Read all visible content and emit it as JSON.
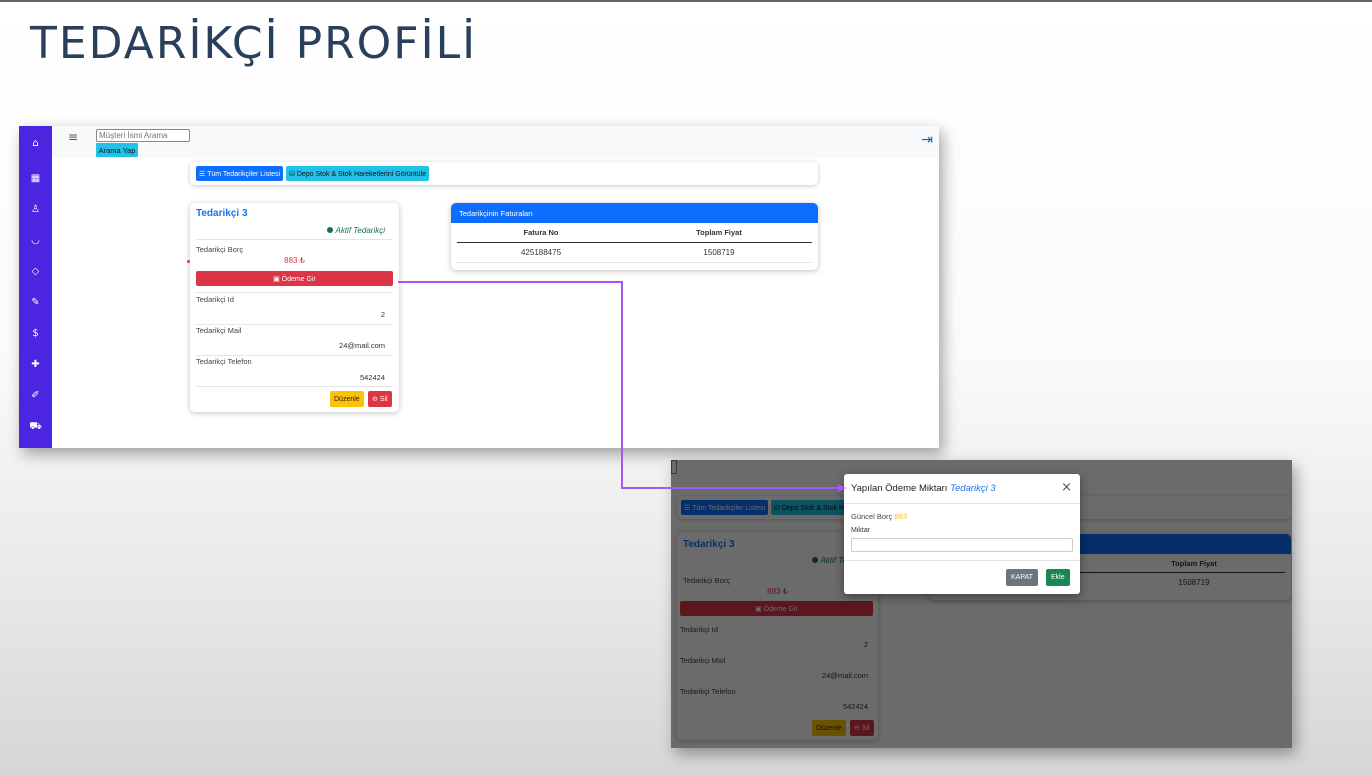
{
  "slide": {
    "title": "TEDARİKÇİ PROFİLİ"
  },
  "app": {
    "search_placeholder": "Müşteri İsmi Arama",
    "search_button": "Arama Yap",
    "sidebar_icons": [
      "home-icon",
      "grid-icon",
      "user-icon",
      "basket-icon",
      "tag-icon",
      "pencil-icon",
      "dollar-icon",
      "plus-icon",
      "brush-icon",
      "truck-icon"
    ],
    "buttons": {
      "all_suppliers": "Tüm Tedarikçiler Listesi",
      "stock_view": "Depo Stok & Stok Hareketlerini Görüntüle"
    },
    "supplier_card": {
      "name": "Tedarikçi 3",
      "status": "Aktif Tedarikçi",
      "debt_label": "Tedarikçi Borç",
      "debt_value": "883 ₺",
      "pay_button": "Ödeme Gir",
      "id_label": "Tedarikçi Id",
      "id_value": "2",
      "mail_label": "Tedarikçi Mail",
      "mail_value": "24@mail.com",
      "phone_label": "Tedarikçi Telefon",
      "phone_value": "542424",
      "edit_button": "Düzenle",
      "delete_button": "Sil"
    },
    "invoices": {
      "header": "Tedarikçinin Faturaları",
      "columns": [
        "Fatura No",
        "Toplam Fiyat"
      ],
      "rows": [
        [
          "425188475",
          "1508719"
        ]
      ]
    }
  },
  "modal": {
    "title": "Yapılan Ödeme Miktarı",
    "title_name": "Tedarikçi 3",
    "current_debt_label": "Güncel Borç",
    "current_debt_value": "883",
    "amount_label": "Miktar",
    "close_button": "KAPAT",
    "add_button": "Ekle"
  },
  "colors": {
    "sidebar": "#4b25e0",
    "primary": "#0d6efd",
    "danger": "#dc3545",
    "warning": "#ffc107",
    "success": "#198754",
    "connector": "#a855f7"
  }
}
